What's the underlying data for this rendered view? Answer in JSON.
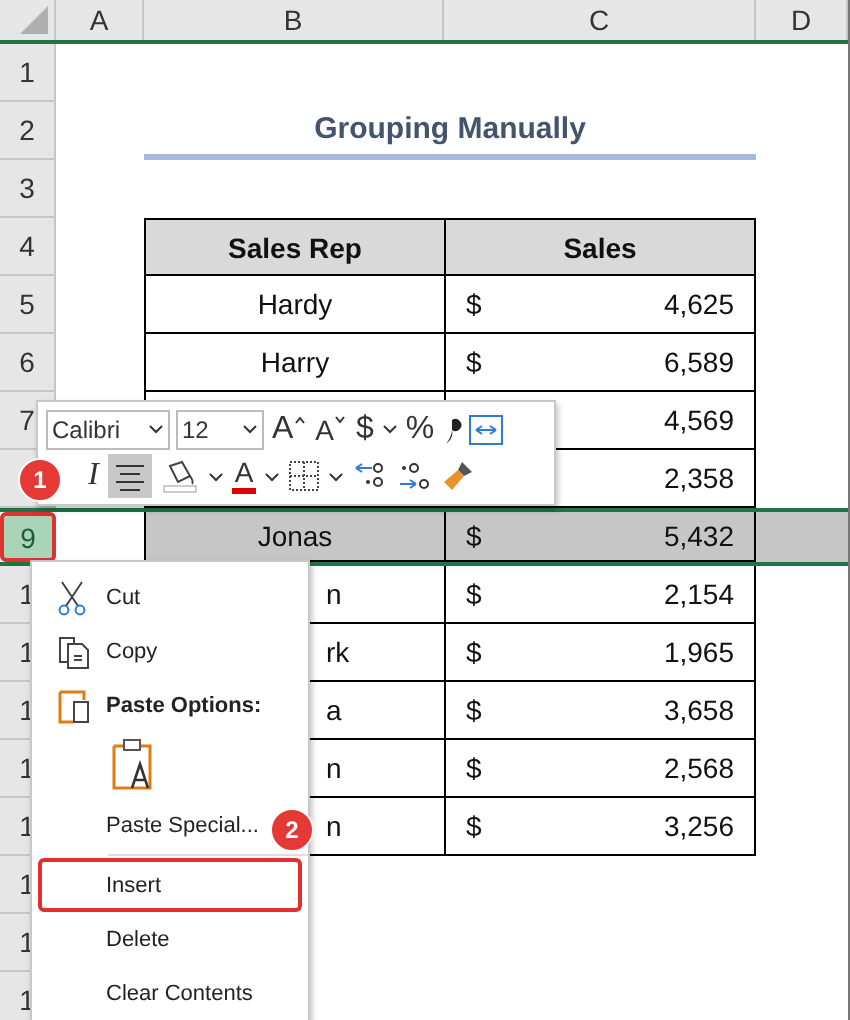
{
  "columns": [
    "A",
    "B",
    "C",
    "D"
  ],
  "rows": [
    {
      "header": "1",
      "selected": false,
      "outlined": false
    },
    {
      "header": "2",
      "selected": false,
      "outlined": false
    },
    {
      "header": "3",
      "selected": false,
      "outlined": false
    },
    {
      "header": "4",
      "selected": false,
      "outlined": false
    },
    {
      "header": "5",
      "selected": false,
      "outlined": false
    },
    {
      "header": "6",
      "selected": false,
      "outlined": false
    },
    {
      "header": "7",
      "selected": false,
      "outlined": false
    },
    {
      "selected": false,
      "outlined": false
    },
    {
      "header": "9",
      "selected": true,
      "outlined": true
    },
    {
      "header": "1",
      "selected": false,
      "outlined": false
    },
    {
      "header": "1",
      "selected": false,
      "outlined": false
    },
    {
      "header": "1",
      "selected": false,
      "outlined": false
    },
    {
      "header": "1",
      "selected": false,
      "outlined": false
    },
    {
      "header": "1",
      "selected": false,
      "outlined": false
    },
    {
      "header": "1",
      "selected": false,
      "outlined": false
    },
    {
      "header": "1",
      "selected": false,
      "outlined": false
    },
    {
      "header": "1",
      "selected": false,
      "outlined": false
    }
  ],
  "title": "Grouping Manually",
  "table": {
    "columns": [
      "Sales Rep",
      "Sales"
    ],
    "rows": [
      {
        "name": "Hardy",
        "currency": "$",
        "sales": "4,625"
      },
      {
        "name": "Harry",
        "currency": "$",
        "sales": "6,589"
      },
      {
        "sales": "4,569"
      },
      {
        "sales": "2,358"
      },
      {
        "name": "Jonas",
        "currency": "$",
        "sales": "5,432"
      },
      {
        "name": "n",
        "currency": "$",
        "sales": "2,154"
      },
      {
        "name": "rk",
        "currency": "$",
        "sales": "1,965"
      },
      {
        "name": "a",
        "currency": "$",
        "sales": "3,658"
      },
      {
        "name": "n",
        "currency": "$",
        "sales": "2,568"
      },
      {
        "name": "n",
        "currency": "$",
        "sales": "3,256"
      }
    ]
  },
  "toolbar": {
    "font": "Calibri",
    "size": "12",
    "grow_font": "A",
    "shrink_font": "A",
    "currency": "$",
    "percent": "%",
    "italic": "I",
    "font_color": "A",
    "center_selected": true,
    "badge": "1"
  },
  "menu": {
    "badge": "2",
    "items": [
      {
        "kind": "cut",
        "label": "Cut",
        "outlined": false
      },
      {
        "kind": "copy",
        "label": "Copy",
        "outlined": false
      },
      {
        "kind": "paste-heading",
        "label": "Paste Options:",
        "outlined": false
      },
      {
        "kind": "paste-option",
        "outlined": false
      },
      {
        "kind": "plain",
        "label": "Paste Special...",
        "outlined": false
      },
      {
        "kind": "separator"
      },
      {
        "kind": "plain",
        "label": "Insert",
        "outlined": true
      },
      {
        "kind": "plain",
        "label": "Delete",
        "outlined": false
      },
      {
        "kind": "plain",
        "label": "Clear Contents",
        "outlined": false
      }
    ]
  }
}
